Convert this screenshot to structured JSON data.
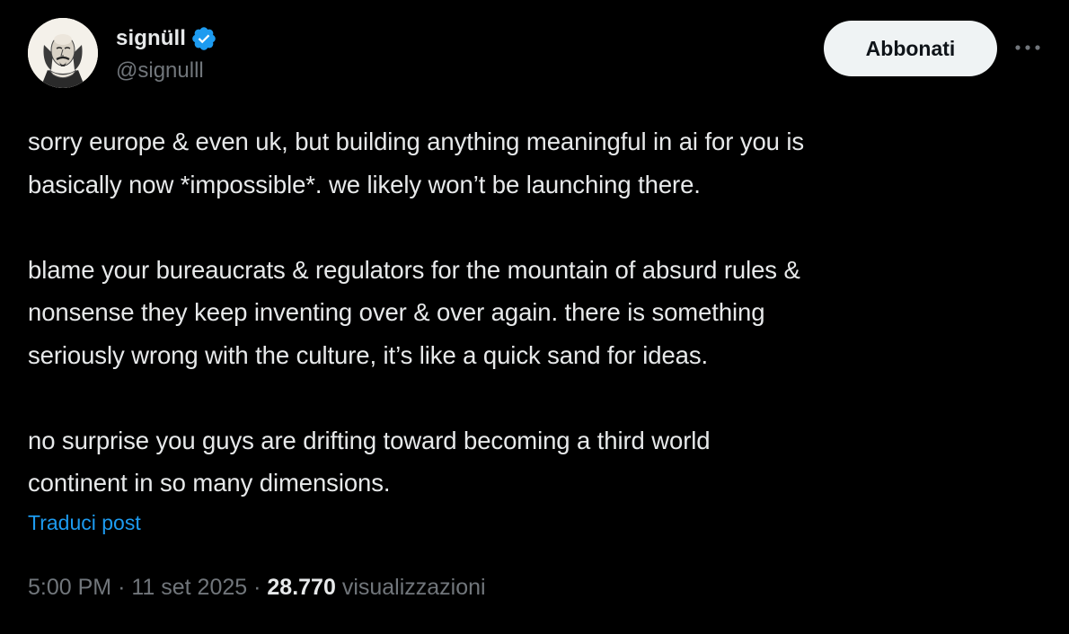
{
  "author": {
    "display_name": "signüll",
    "handle": "@signulll",
    "verified": true,
    "avatar_icon": "shakespeare-portrait-icon"
  },
  "actions": {
    "subscribe_label": "Abbonati",
    "more_icon": "more-horizontal-icon"
  },
  "tweet": {
    "paragraphs": [
      [
        "sorry europe & even uk, but building anything meaningful in ai for you is",
        "basically now *impossible*. we likely won’t be launching there."
      ],
      [
        "blame your bureaucrats & regulators for the mountain of absurd rules &",
        "nonsense they keep inventing over & over again. there is something",
        "seriously wrong with the culture, it’s like a quick sand for ideas."
      ],
      [
        "no surprise you guys are drifting toward becoming a third world",
        "continent in so many dimensions."
      ]
    ],
    "translate_label": "Traduci post"
  },
  "meta": {
    "time": "5:00 PM",
    "separator": "·",
    "date": "11 set 2025",
    "views_count": "28.770",
    "views_label": "visualizzazioni"
  },
  "colors": {
    "background": "#000000",
    "text": "#e7e9ea",
    "secondary": "#71767b",
    "link": "#1d9bf0",
    "verified": "#1d9bf0",
    "button_bg": "#eff3f4"
  }
}
